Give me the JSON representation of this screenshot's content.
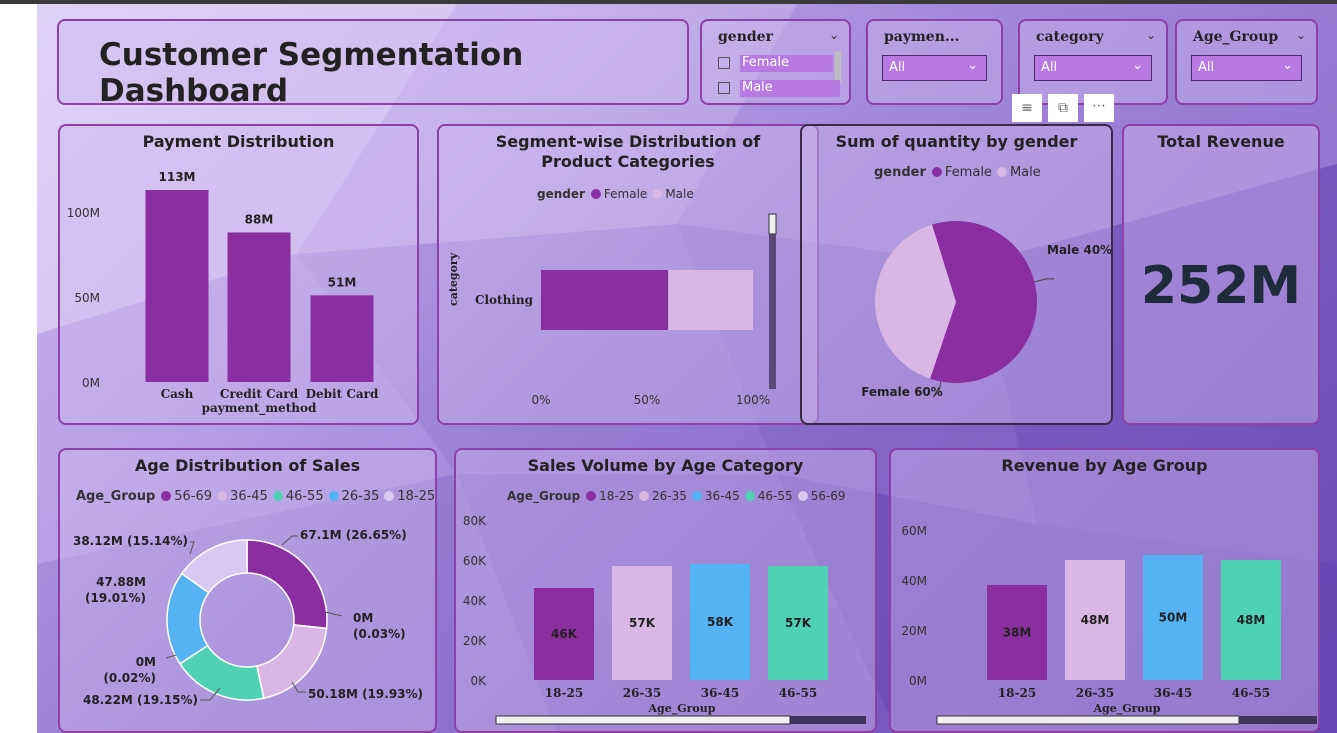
{
  "title": "Customer Segmentation Dashboard",
  "slicers": {
    "gender": {
      "title": "gender",
      "items": [
        "Female",
        "Male"
      ]
    },
    "payment": {
      "title": "paymen...",
      "value": "All"
    },
    "category": {
      "title": "category",
      "value": "All"
    },
    "age_group": {
      "title": "Age_Group",
      "value": "All"
    }
  },
  "toolbar_icons": [
    "filter-icon",
    "focus-mode-icon",
    "more-options-icon"
  ],
  "colors": {
    "female": "#8b2fa0",
    "male": "#d9b6e3",
    "g18_25": "#8b2fa0",
    "g26_35": "#d9b6e3",
    "g36_45": "#55b3f3",
    "g46_55": "#4fd1b3",
    "g56_69": "#d8c9f3"
  },
  "payment_chart": {
    "title": "Payment Distribution",
    "xlabel": "payment_method",
    "ylabels": [
      "100M",
      "50M",
      "0M"
    ]
  },
  "segment_chart": {
    "title_line1": "Segment-wise Distribution of",
    "title_line2": "Product Categories",
    "legend_title": "gender",
    "ylabel": "category",
    "ticks": [
      "0%",
      "50%",
      "100%"
    ]
  },
  "pie_chart": {
    "title": "Sum of quantity by gender",
    "legend_title": "gender"
  },
  "kpi": {
    "title": "Total Revenue",
    "value": "252M"
  },
  "donut_chart": {
    "title": "Age Distribution of Sales",
    "legend_title": "Age_Group"
  },
  "sales_chart": {
    "title": "Sales Volume by Age Category",
    "legend_title": "Age_Group",
    "xlabel": "Age_Group",
    "yticks": [
      "80K",
      "60K",
      "40K",
      "20K",
      "0K"
    ]
  },
  "revenue_chart": {
    "title": "Revenue by Age Group",
    "xlabel": "Age_Group",
    "yticks": [
      "60M",
      "40M",
      "20M",
      "0M"
    ]
  },
  "chart_data": [
    {
      "id": "payment",
      "type": "bar",
      "title": "Payment Distribution",
      "xlabel": "payment_method",
      "categories": [
        "Cash",
        "Credit Card",
        "Debit Card"
      ],
      "values": [
        113,
        88,
        51
      ],
      "labels": [
        "113M",
        "88M",
        "51M"
      ],
      "ylim": [
        0,
        113
      ]
    },
    {
      "id": "segment",
      "type": "bar",
      "title": "Segment-wise Distribution of Product Categories",
      "ylabel": "category",
      "categories": [
        "Clothing"
      ],
      "series": [
        {
          "name": "Female",
          "values": [
            0.6
          ]
        },
        {
          "name": "Male",
          "values": [
            0.4
          ]
        }
      ],
      "xlim": [
        0,
        1
      ]
    },
    {
      "id": "pie",
      "type": "pie",
      "title": "Sum of quantity by gender",
      "categories": [
        "Female",
        "Male"
      ],
      "values": [
        60,
        40
      ],
      "labels": [
        "Female 60%",
        "Male 40%"
      ]
    },
    {
      "id": "donut",
      "type": "pie",
      "title": "Age Distribution of Sales",
      "categories": [
        "56-69",
        "36-45",
        "46-55",
        "26-35",
        "18-25"
      ],
      "slices": [
        {
          "category": "18-25",
          "value": 67.1,
          "label": "67.1M (26.65%)"
        },
        {
          "category": "56-69",
          "value": 0.07,
          "label_l1": "0M",
          "label_l2": "(0.03%)"
        },
        {
          "category": "26-35",
          "value": 50.18,
          "label": "50.18M (19.93%)"
        },
        {
          "category": "46-55",
          "value": 48.22,
          "label": "48.22M (19.15%)"
        },
        {
          "category": "56-69",
          "value": 0.05,
          "label_l1": "0M",
          "label_l2": "(0.02%)"
        },
        {
          "category": "36-45",
          "value": 47.88,
          "label_l1": "47.88M",
          "label_l2": "(19.01%)"
        },
        {
          "category": "56-69",
          "value": 38.12,
          "label": "38.12M (15.14%)"
        }
      ]
    },
    {
      "id": "sales",
      "type": "bar",
      "title": "Sales Volume by Age Category",
      "xlabel": "Age_Group",
      "categories": [
        "18-25",
        "26-35",
        "36-45",
        "46-55"
      ],
      "legend": [
        "18-25",
        "26-35",
        "36-45",
        "46-55",
        "56-69"
      ],
      "values": [
        46,
        57,
        58,
        57
      ],
      "labels": [
        "46K",
        "57K",
        "58K",
        "57K"
      ],
      "ylim": [
        0,
        80
      ]
    },
    {
      "id": "revenue",
      "type": "bar",
      "title": "Revenue by Age Group",
      "xlabel": "Age_Group",
      "categories": [
        "18-25",
        "26-35",
        "36-45",
        "46-55"
      ],
      "values": [
        38,
        48,
        50,
        48
      ],
      "labels": [
        "38M",
        "48M",
        "50M",
        "48M"
      ],
      "ylim": [
        0,
        60
      ]
    }
  ]
}
